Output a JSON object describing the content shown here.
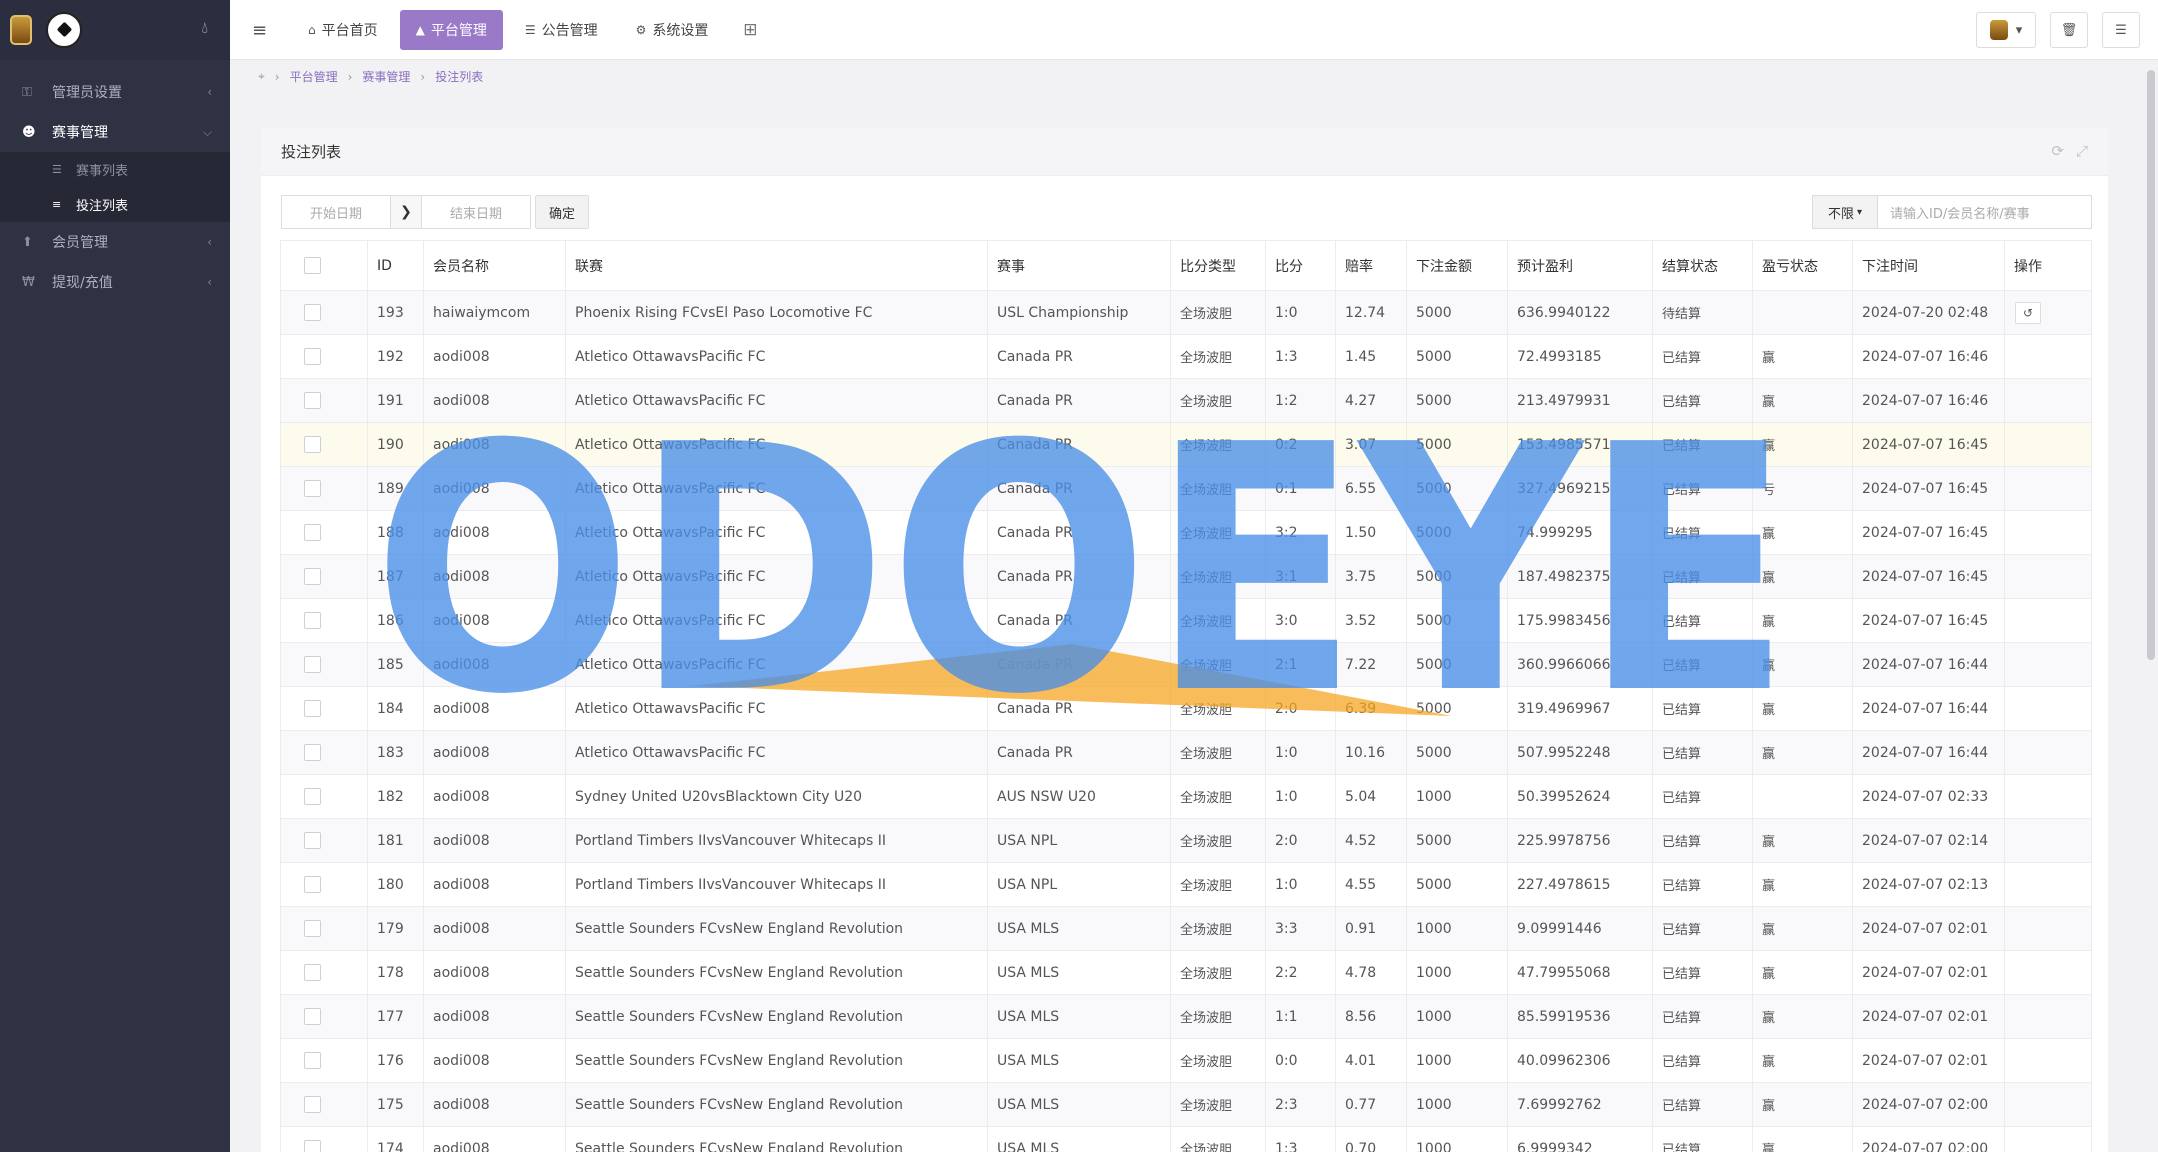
{
  "sidebar": {
    "items": [
      {
        "label": "管理员设置",
        "icon": "key-icon"
      },
      {
        "label": "赛事管理",
        "icon": "users-icon"
      },
      {
        "label": "会员管理",
        "icon": "arrow-up-icon"
      },
      {
        "label": "提现/充值",
        "icon": "won-icon"
      }
    ],
    "subitems": [
      {
        "label": "赛事列表"
      },
      {
        "label": "投注列表"
      }
    ]
  },
  "topnav": {
    "tabs": [
      {
        "label": "平台首页",
        "icon": "home-icon"
      },
      {
        "label": "平台管理",
        "icon": "user-icon"
      },
      {
        "label": "公告管理",
        "icon": "list-icon"
      },
      {
        "label": "系统设置",
        "icon": "gear-icon"
      }
    ]
  },
  "breadcrumb": [
    "平台管理",
    "赛事管理",
    "投注列表"
  ],
  "panel": {
    "title": "投注列表"
  },
  "filter": {
    "start_placeholder": "开始日期",
    "end_placeholder": "结束日期",
    "confirm_label": "确定",
    "scope_label": "不限",
    "search_placeholder": "请输入ID/会员名称/赛事"
  },
  "table": {
    "headers": [
      "ID",
      "会员名称",
      "联赛",
      "赛事",
      "比分类型",
      "比分",
      "赔率",
      "下注金额",
      "预计盈利",
      "结算状态",
      "盈亏状态",
      "下注时间",
      "操作"
    ],
    "rows": [
      [
        "193",
        "haiwaiymcom",
        "Phoenix Rising FCvsEl Paso Locomotive FC",
        "USL Championship",
        "全场波胆",
        "1:0",
        "12.74",
        "5000",
        "636.9940122",
        "待结算",
        "",
        "2024-07-20 02:48"
      ],
      [
        "192",
        "aodi008",
        "Atletico OttawavsPacific FC",
        "Canada PR",
        "全场波胆",
        "1:3",
        "1.45",
        "5000",
        "72.4993185",
        "已结算",
        "赢",
        "2024-07-07 16:46"
      ],
      [
        "191",
        "aodi008",
        "Atletico OttawavsPacific FC",
        "Canada PR",
        "全场波胆",
        "1:2",
        "4.27",
        "5000",
        "213.4979931",
        "已结算",
        "赢",
        "2024-07-07 16:46"
      ],
      [
        "190",
        "aodi008",
        "Atletico OttawavsPacific FC",
        "Canada PR",
        "全场波胆",
        "0:2",
        "3.07",
        "5000",
        "153.4985571",
        "已结算",
        "赢",
        "2024-07-07 16:45"
      ],
      [
        "189",
        "aodi008",
        "Atletico OttawavsPacific FC",
        "Canada PR",
        "全场波胆",
        "0:1",
        "6.55",
        "5000",
        "327.4969215",
        "已结算",
        "亏",
        "2024-07-07 16:45"
      ],
      [
        "188",
        "aodi008",
        "Atletico OttawavsPacific FC",
        "Canada PR",
        "全场波胆",
        "3:2",
        "1.50",
        "5000",
        "74.999295",
        "已结算",
        "赢",
        "2024-07-07 16:45"
      ],
      [
        "187",
        "aodi008",
        "Atletico OttawavsPacific FC",
        "Canada PR",
        "全场波胆",
        "3:1",
        "3.75",
        "5000",
        "187.4982375",
        "已结算",
        "赢",
        "2024-07-07 16:45"
      ],
      [
        "186",
        "aodi008",
        "Atletico OttawavsPacific FC",
        "Canada PR",
        "全场波胆",
        "3:0",
        "3.52",
        "5000",
        "175.9983456",
        "已结算",
        "赢",
        "2024-07-07 16:45"
      ],
      [
        "185",
        "aodi008",
        "Atletico OttawavsPacific FC",
        "Canada PR",
        "全场波胆",
        "2:1",
        "7.22",
        "5000",
        "360.9966066",
        "已结算",
        "赢",
        "2024-07-07 16:44"
      ],
      [
        "184",
        "aodi008",
        "Atletico OttawavsPacific FC",
        "Canada PR",
        "全场波胆",
        "2:0",
        "6.39",
        "5000",
        "319.4969967",
        "已结算",
        "赢",
        "2024-07-07 16:44"
      ],
      [
        "183",
        "aodi008",
        "Atletico OttawavsPacific FC",
        "Canada PR",
        "全场波胆",
        "1:0",
        "10.16",
        "5000",
        "507.9952248",
        "已结算",
        "赢",
        "2024-07-07 16:44"
      ],
      [
        "182",
        "aodi008",
        "Sydney United U20vsBlacktown City U20",
        "AUS NSW U20",
        "全场波胆",
        "1:0",
        "5.04",
        "1000",
        "50.39952624",
        "已结算",
        "",
        "2024-07-07 02:33"
      ],
      [
        "181",
        "aodi008",
        "Portland Timbers IIvsVancouver Whitecaps II",
        "USA NPL",
        "全场波胆",
        "2:0",
        "4.52",
        "5000",
        "225.9978756",
        "已结算",
        "赢",
        "2024-07-07 02:14"
      ],
      [
        "180",
        "aodi008",
        "Portland Timbers IIvsVancouver Whitecaps II",
        "USA NPL",
        "全场波胆",
        "1:0",
        "4.55",
        "5000",
        "227.4978615",
        "已结算",
        "赢",
        "2024-07-07 02:13"
      ],
      [
        "179",
        "aodi008",
        "Seattle Sounders FCvsNew England Revolution",
        "USA MLS",
        "全场波胆",
        "3:3",
        "0.91",
        "1000",
        "9.09991446",
        "已结算",
        "赢",
        "2024-07-07 02:01"
      ],
      [
        "178",
        "aodi008",
        "Seattle Sounders FCvsNew England Revolution",
        "USA MLS",
        "全场波胆",
        "2:2",
        "4.78",
        "1000",
        "47.79955068",
        "已结算",
        "赢",
        "2024-07-07 02:01"
      ],
      [
        "177",
        "aodi008",
        "Seattle Sounders FCvsNew England Revolution",
        "USA MLS",
        "全场波胆",
        "1:1",
        "8.56",
        "1000",
        "85.59919536",
        "已结算",
        "赢",
        "2024-07-07 02:01"
      ],
      [
        "176",
        "aodi008",
        "Seattle Sounders FCvsNew England Revolution",
        "USA MLS",
        "全场波胆",
        "0:0",
        "4.01",
        "1000",
        "40.09962306",
        "已结算",
        "赢",
        "2024-07-07 02:01"
      ],
      [
        "175",
        "aodi008",
        "Seattle Sounders FCvsNew England Revolution",
        "USA MLS",
        "全场波胆",
        "2:3",
        "0.77",
        "1000",
        "7.69992762",
        "已结算",
        "赢",
        "2024-07-07 02:00"
      ],
      [
        "174",
        "aodi008",
        "Seattle Sounders FCvsNew England Revolution",
        "USA MLS",
        "全场波胆",
        "1:3",
        "0.70",
        "1000",
        "6.9999342",
        "已结算",
        "赢",
        "2024-07-07 02:00"
      ]
    ]
  },
  "watermark": {
    "text": "ODOEYE"
  },
  "colors": {
    "accent": "#9a79c9",
    "sidebar_bg": "#2f3243",
    "watermark_blue": "#4a8fe7",
    "watermark_orange": "#f5a623"
  }
}
